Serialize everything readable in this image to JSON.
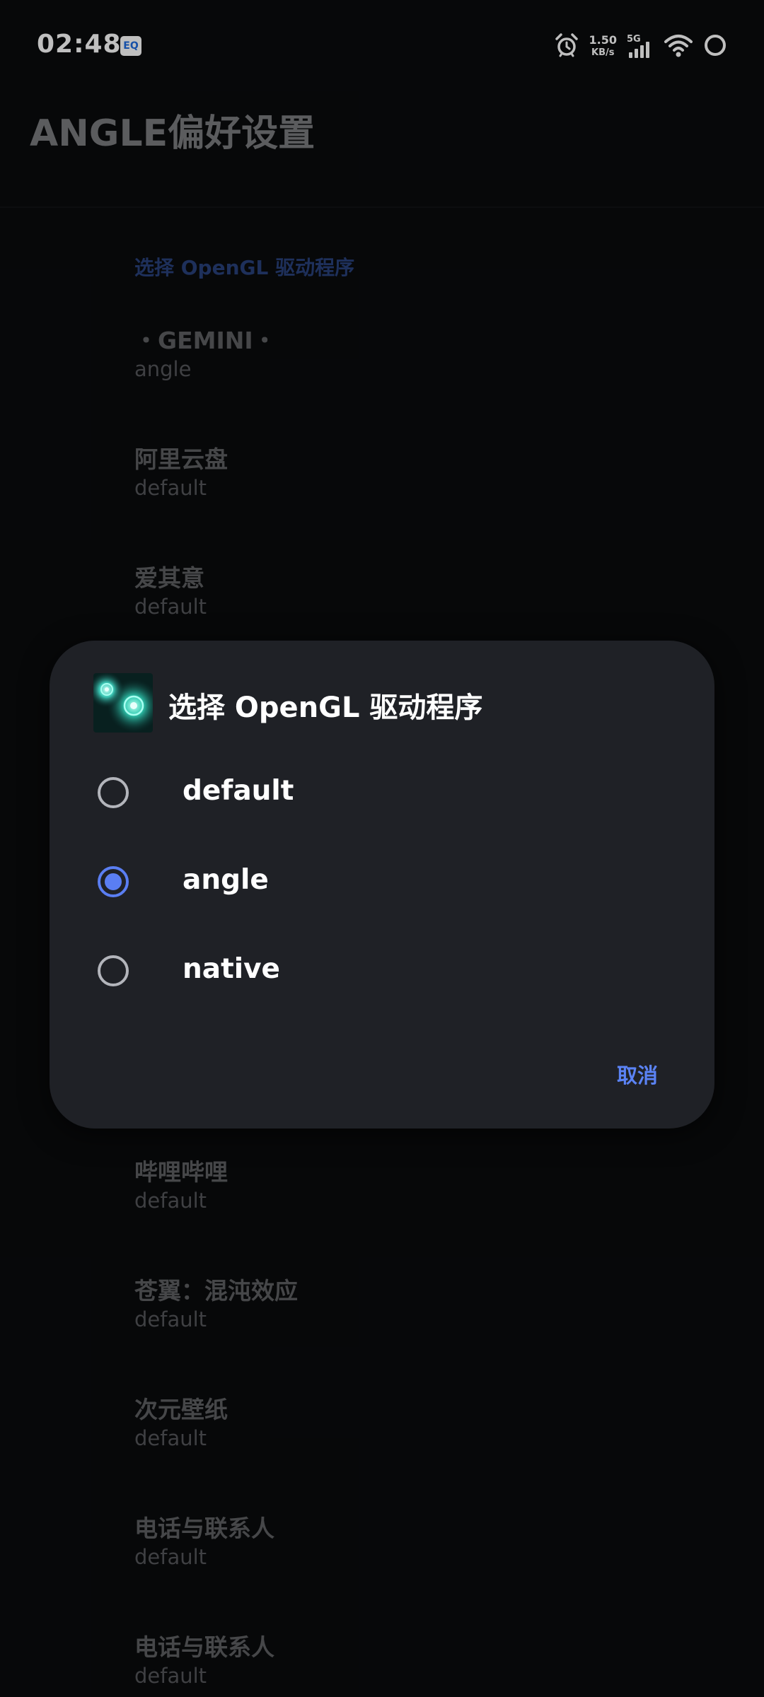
{
  "status_bar": {
    "time": "02:48",
    "eq_badge": "EQ",
    "net_speed_value": "1.50",
    "net_speed_unit": "KB/s",
    "network_type": "5G",
    "icons": [
      "alarm-icon",
      "signal-icon",
      "wifi-icon",
      "ring-icon"
    ]
  },
  "app": {
    "title": "ANGLE偏好设置",
    "section_header": "选择 OpenGL 驱动程序",
    "items": [
      {
        "title": "・GEMINI・",
        "value": "angle"
      },
      {
        "title": "阿里云盘",
        "value": "default"
      },
      {
        "title": "爱其意",
        "value": "default"
      },
      {
        "title": "哔哩哔哩",
        "value": "default"
      },
      {
        "title": "苍翼：混沌效应",
        "value": "default"
      },
      {
        "title": "次元壁纸",
        "value": "default"
      },
      {
        "title": "电话与联系人",
        "value": "default"
      },
      {
        "title": "电话与联系人",
        "value": "default"
      }
    ]
  },
  "dialog": {
    "title": "选择 OpenGL 驱动程序",
    "options": [
      {
        "label": "default",
        "selected": false
      },
      {
        "label": "angle",
        "selected": true
      },
      {
        "label": "native",
        "selected": false
      }
    ],
    "cancel_label": "取消"
  },
  "colors": {
    "accent": "#5a7ef2",
    "cancel": "#5b83f5",
    "dialog_bg": "#1f2126",
    "screen_bg": "#0a0b0d"
  }
}
